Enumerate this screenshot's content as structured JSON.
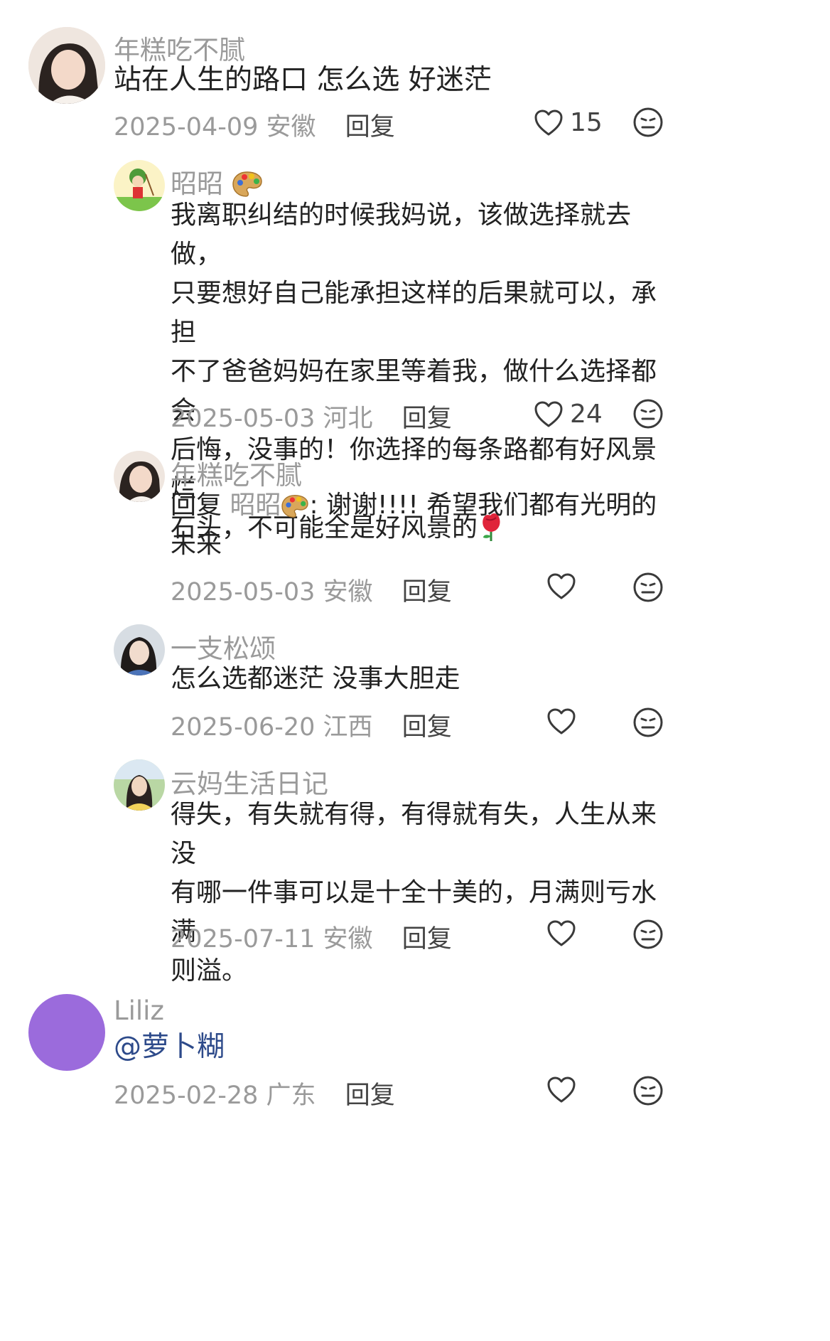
{
  "comments": [
    {
      "username": "年糕吃不腻",
      "text": "站在人生的路口 怎么选 好迷茫",
      "date": "2025-04-09",
      "location": "安徽",
      "reply_label": "回复",
      "likes": "15"
    },
    {
      "username": "昭昭",
      "text_lines": [
        "我离职纠结的时候我妈说，该做选择就去做，",
        "只要想好自己能承担这样的后果就可以，承担",
        "不了爸爸妈妈在家里等着我，做什么选择都会",
        "后悔，没事的！你选择的每条路都有好风景烂",
        "石头，不可能全是好风景的"
      ],
      "date": "2025-05-03",
      "location": "河北",
      "reply_label": "回复",
      "likes": "24"
    },
    {
      "username": "年糕吃不腻",
      "reply_prefix": "回复",
      "reply_to": "昭昭",
      "text_line1": ": 谢谢!!!! 希望我们都有光明的",
      "text_line2": "未来",
      "date": "2025-05-03",
      "location": "安徽",
      "reply_label": "回复"
    },
    {
      "username": "一支松颂",
      "text": "怎么选都迷茫 没事大胆走",
      "date": "2025-06-20",
      "location": "江西",
      "reply_label": "回复"
    },
    {
      "username": "云妈生活日记",
      "text_lines": [
        "得失，有失就有得，有得就有失，人生从来没",
        "有哪一件事可以是十全十美的，月满则亏水满",
        "则溢。"
      ],
      "date": "2025-07-11",
      "location": "安徽",
      "reply_label": "回复"
    },
    {
      "username": "Liliz",
      "text": "@萝卜糊",
      "date": "2025-02-28",
      "location": "广东",
      "reply_label": "回复"
    }
  ],
  "icons": {
    "like": "heart-outline-icon",
    "dislike": "meh-face-icon",
    "palette": "palette-emoji",
    "rose": "rose-emoji"
  },
  "colors": {
    "name_gray": "#9a9a9a",
    "text": "#222222",
    "liliz_avatar": "#9b6bdc"
  }
}
